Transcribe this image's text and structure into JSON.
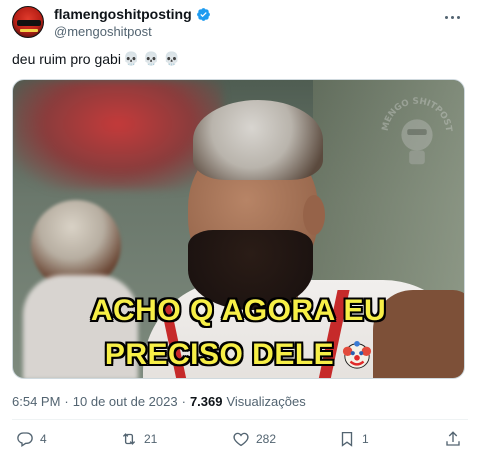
{
  "account": {
    "name": "flamengoshitposting",
    "handle": "@mengoshitpost"
  },
  "post": {
    "text": "deu ruim pro gabi",
    "emoji": "💀 💀 💀",
    "caption_line1": "ACHO Q AGORA EU",
    "caption_line2": "PRECISO DELE",
    "watermark_text": "FLAMENGO SHITPOSTING"
  },
  "meta": {
    "time": "6:54 PM",
    "date": "10 de out de 2023",
    "views_count": "7.369",
    "views_label": "Visualizações"
  },
  "actions": {
    "replies": "4",
    "reposts": "21",
    "likes": "282",
    "bookmarks": "1"
  },
  "colors": {
    "verified": "#1d9bf0",
    "caption": "#f7ef47",
    "muted": "#536471"
  }
}
